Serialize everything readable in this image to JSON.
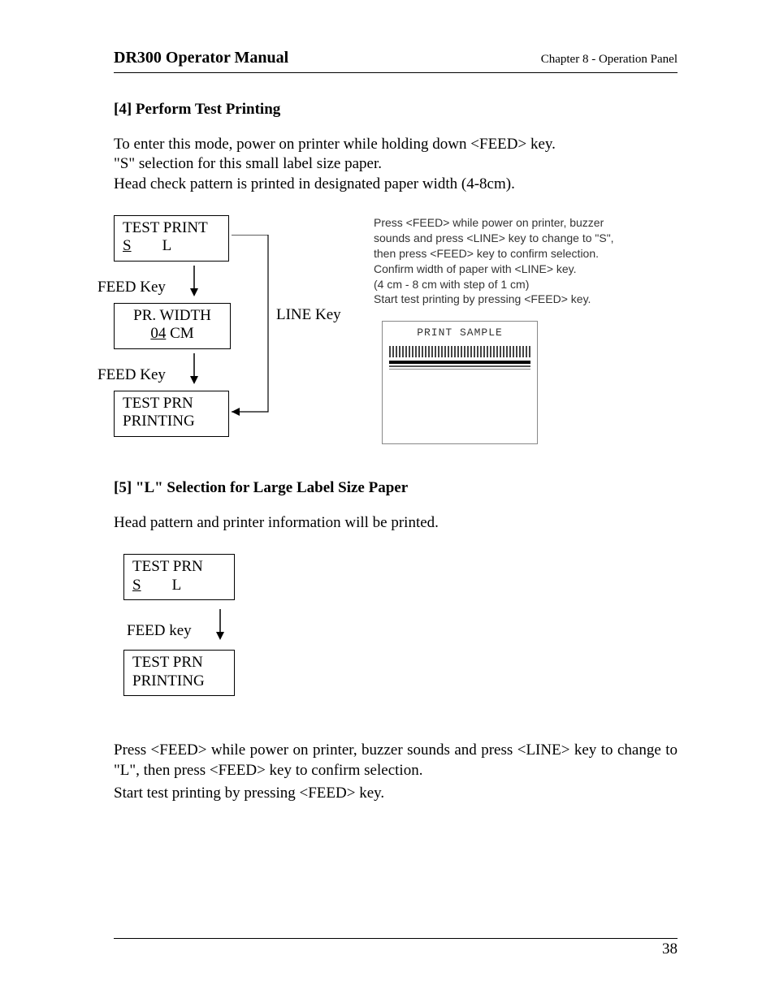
{
  "header": {
    "manual_title": "DR300 Operator Manual",
    "chapter": "Chapter 8 - Operation Panel"
  },
  "section4": {
    "heading": "[4] Perform Test Printing",
    "para1": "To enter this mode, power on printer while holding down <FEED> key.",
    "para2": "\"S\" selection for this small label size paper.",
    "para3": "Head check pattern is printed in designated paper width (4-8cm).",
    "lcd1_line1": "TEST PRINT",
    "lcd1_S": "S",
    "lcd1_L": "L",
    "feed_key": "FEED Key",
    "lcd2_line1": "PR. WIDTH",
    "lcd2_val": "04",
    "lcd2_unit": " CM",
    "lcd3_line1": "TEST PRN",
    "lcd3_line2": "PRINTING",
    "line_key": "LINE Key",
    "notes1": "Press <FEED> while power on printer, buzzer sounds and press <LINE> key to change to \"S\", then press <FEED> key to confirm selection.",
    "notes2": "Confirm width of paper with <LINE> key.",
    "notes3": "(4 cm - 8 cm with step of 1 cm)",
    "notes4": "Start test printing by pressing <FEED> key.",
    "sample_title": "PRINT  SAMPLE"
  },
  "section5": {
    "heading": "[5] \"L\" Selection for Large Label Size Paper",
    "para1": "Head pattern and printer information will be printed.",
    "lcd1_line1": "TEST PRN",
    "lcd1_S": "S",
    "lcd1_L": "L",
    "feed_key": "FEED key",
    "lcd2_line1": "TEST PRN",
    "lcd2_line2": "PRINTING",
    "para2": "Press <FEED> while power on printer, buzzer sounds and press <LINE> key to change to \"L\", then press <FEED> key to confirm selection.",
    "para3": "Start test printing by pressing <FEED> key."
  },
  "page_number": "38"
}
